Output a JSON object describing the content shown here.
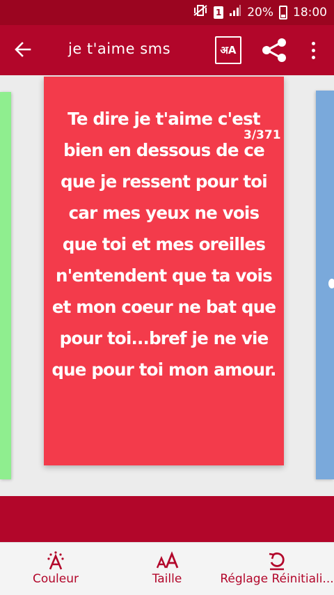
{
  "status_bar": {
    "sim": "1",
    "battery": "20%",
    "time": "18:00"
  },
  "toolbar": {
    "title": "je t'aime sms",
    "translate_glyphs": "अA"
  },
  "card": {
    "counter": "3/371",
    "message": "Te dire je t'aime c'est bien en dessous de ce que je ressent pour toi car mes yeux ne vois que toi et mes oreilles n'entendent que ta vois et mon coeur ne bat que pour toi...bref je ne vie que pour toi mon amour."
  },
  "bottom_nav": {
    "couleur": "Couleur",
    "taille": "Taille",
    "reglage": "Réglage Réinitiali..."
  },
  "colors": {
    "accent": "#b2062a",
    "card_bg": "#f33b4b",
    "left_card": "#8fee8f",
    "right_card": "#7aa9db"
  }
}
